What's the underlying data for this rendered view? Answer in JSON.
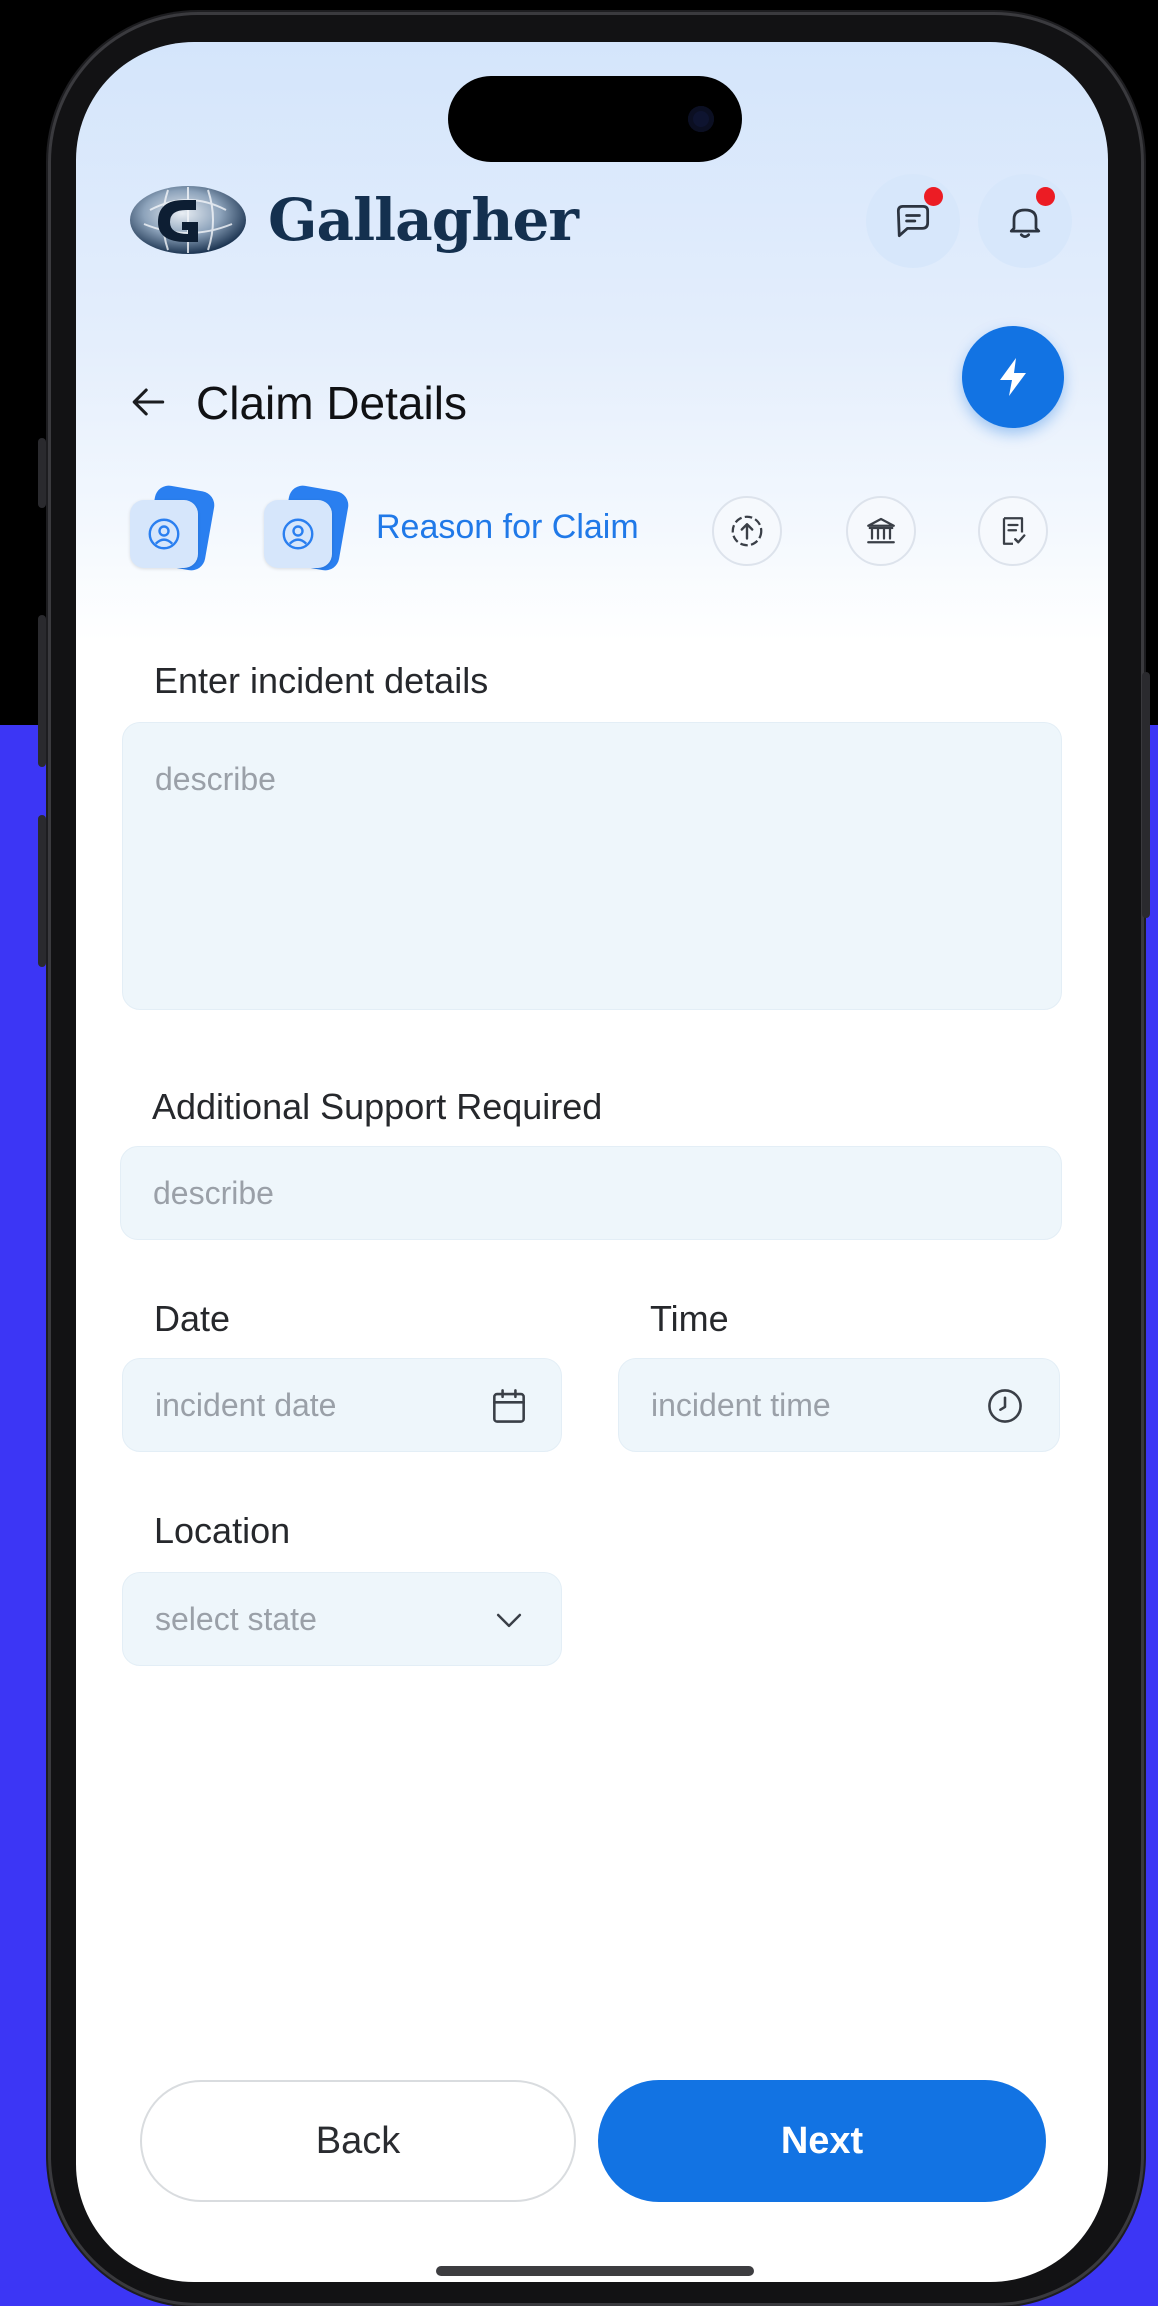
{
  "app": {
    "brand": "Gallagher"
  },
  "header": {
    "title": "Claim Details",
    "icons": {
      "back": "arrow-left-icon",
      "messages": "chat-icon",
      "notifications": "bell-icon",
      "quick_action": "lightning-bolt-icon"
    },
    "badge_color": "#ec1c24"
  },
  "stepper": {
    "current_label": "Reason for Claim",
    "steps": [
      {
        "icon": "user-icon",
        "state": "done"
      },
      {
        "icon": "user-icon",
        "state": "current"
      },
      {
        "icon": "upload-icon",
        "state": "upcoming"
      },
      {
        "icon": "bank-icon",
        "state": "upcoming"
      },
      {
        "icon": "checklist-icon",
        "state": "upcoming"
      }
    ]
  },
  "form": {
    "incident": {
      "label": "Enter incident details",
      "placeholder": "describe",
      "value": ""
    },
    "support": {
      "label": "Additional Support Required",
      "placeholder": "describe",
      "value": ""
    },
    "date": {
      "label": "Date",
      "placeholder": "incident date",
      "icon": "calendar-icon"
    },
    "time": {
      "label": "Time",
      "placeholder": "incident time",
      "icon": "clock-icon"
    },
    "location": {
      "label": "Location",
      "placeholder": "select state",
      "icon": "chevron-down-icon"
    }
  },
  "actions": {
    "back": "Back",
    "next": "Next"
  },
  "colors": {
    "primary": "#1273e3",
    "accent_bg": "#3c36f5",
    "field_bg": "#eef6fb",
    "brand_text": "#14304f"
  }
}
